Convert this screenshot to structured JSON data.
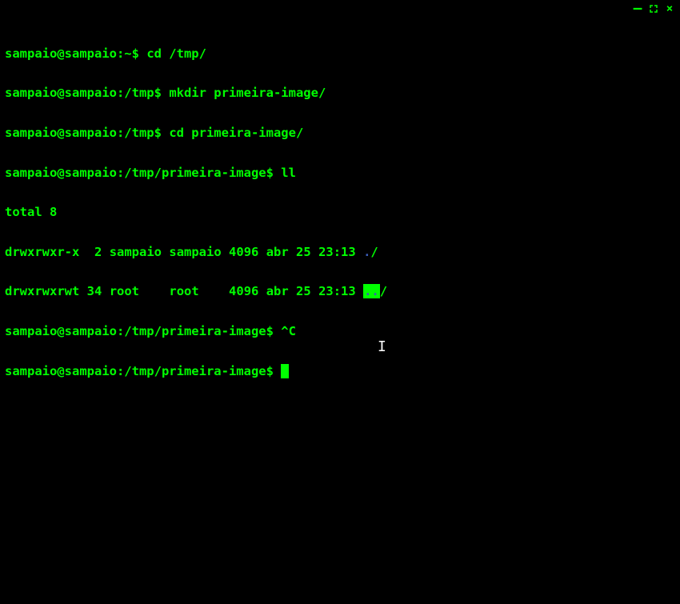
{
  "window": {
    "minimize": "—",
    "close": "×"
  },
  "colors": {
    "background": "#000000",
    "foreground": "#00ff00",
    "directory_blue": "#3b5bb5",
    "cursor": "#00ff00"
  },
  "history": [
    {
      "prompt": "sampaio@sampaio:~$ ",
      "command": "cd /tmp/"
    },
    {
      "prompt": "sampaio@sampaio:/tmp$ ",
      "command": "mkdir primeira-image/"
    },
    {
      "prompt": "sampaio@sampaio:/tmp$ ",
      "command": "cd primeira-image/"
    },
    {
      "prompt": "sampaio@sampaio:/tmp/primeira-image$ ",
      "command": "ll"
    }
  ],
  "output": {
    "total_line": "total 8",
    "rows": [
      {
        "perms": "drwxrwxr-x",
        "links": " 2",
        "owner": "sampaio",
        "group": "sampaio",
        "size": "4096",
        "month": "abr",
        "day": "25",
        "time": "23:13",
        "name_highlight": ".",
        "name_suffix": "/"
      },
      {
        "perms": "drwxrwxrwt",
        "links": "34",
        "owner": "root   ",
        "group": "root   ",
        "size": "4096",
        "month": "abr",
        "day": "25",
        "time": "23:13",
        "name_highlight": "..",
        "name_suffix": "/"
      }
    ]
  },
  "tail": {
    "interrupt_prompt": "sampaio@sampaio:/tmp/primeira-image$ ",
    "interrupt_text": "^C",
    "current_prompt": "sampaio@sampaio:/tmp/primeira-image$ "
  }
}
